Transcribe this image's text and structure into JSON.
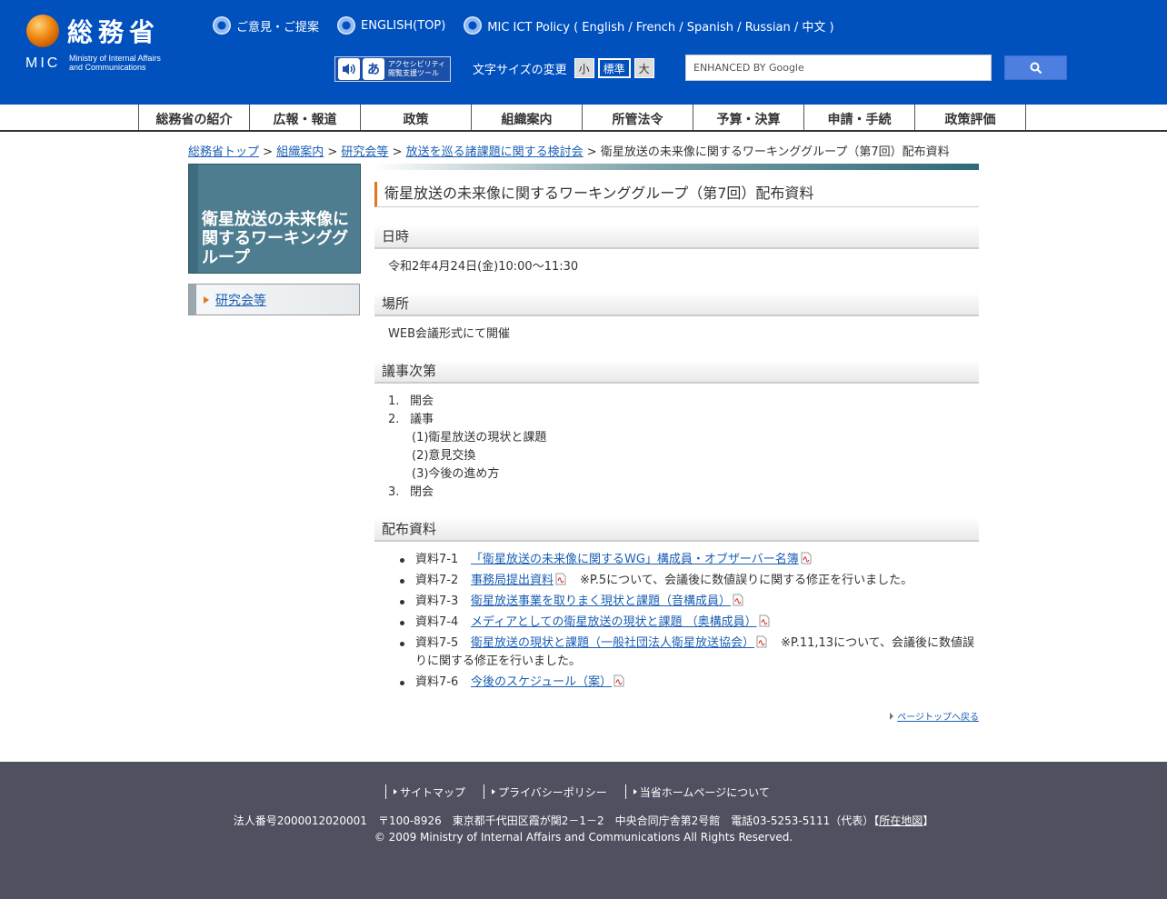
{
  "header": {
    "logo_jp": "総務省",
    "logo_mic": "MIC",
    "logo_en_line1": "Ministry of Internal Affairs",
    "logo_en_line2": "and Communications",
    "links": [
      {
        "label": "ご意見・ご提案"
      },
      {
        "label": "ENGLISH(TOP)"
      },
      {
        "label": "MIC ICT Policy ( English / French / Spanish / Russian / 中文 )"
      }
    ],
    "access_tool_line1": "アクセシビリティ",
    "access_tool_line2": "閲覧支援ツール",
    "fontsize_label": "文字サイズの変更",
    "fontsize_small": "小",
    "fontsize_standard": "標準",
    "fontsize_large": "大",
    "search_placeholder": "ENHANCED BY Google"
  },
  "gnav": [
    "総務省の紹介",
    "広報・報道",
    "政策",
    "組織案内",
    "所管法令",
    "予算・決算",
    "申請・手続",
    "政策評価"
  ],
  "breadcrumb": {
    "items": [
      "総務省トップ",
      "組織案内",
      "研究会等",
      "放送を巡る諸課題に関する検討会"
    ],
    "current": "衛星放送の未来像に関するワーキンググループ（第7回）配布資料",
    "separator": ">"
  },
  "sidebar": {
    "title": "衛星放送の未来像に関するワーキンググループ",
    "menu_item": "研究会等"
  },
  "main": {
    "title": "衛星放送の未来像に関するワーキンググループ（第7回）配布資料",
    "date_heading": "日時",
    "date_text": "令和2年4月24日(金)10:00～11:30",
    "place_heading": "場所",
    "place_text": "WEB会議形式にて開催",
    "agenda_heading": "議事次第",
    "agenda": [
      {
        "num": "1.",
        "label": "開会"
      },
      {
        "num": "2.",
        "label": "議事"
      },
      {
        "num": "3.",
        "label": "閉会"
      }
    ],
    "agenda_sub": [
      "(1)衛星放送の現状と課題",
      "(2)意見交換",
      "(3)今後の進め方"
    ],
    "materials_heading": "配布資料",
    "materials": [
      {
        "no": "資料7-1",
        "title": "「衛星放送の未来像に関するWG」構成員・オブザーバー名簿",
        "note": ""
      },
      {
        "no": "資料7-2",
        "title": "事務局提出資料",
        "note": "※P.5について、会議後に数値誤りに関する修正を行いました。"
      },
      {
        "no": "資料7-3",
        "title": "衛星放送事業を取りまく現状と課題（音構成員）",
        "note": ""
      },
      {
        "no": "資料7-4",
        "title": "メディアとしての衛星放送の現状と課題 （奥構成員）",
        "note": ""
      },
      {
        "no": "資料7-5",
        "title": "衛星放送の現状と課題（一般社団法人衛星放送協会）",
        "note": "※P.11,13について、会議後に数値誤りに関する修正を行いました。"
      },
      {
        "no": "資料7-6",
        "title": "今後のスケジュール（案）",
        "note": ""
      }
    ],
    "pagetop": "ページトップへ戻る"
  },
  "footer": {
    "links": [
      "サイトマップ",
      "プライバシーポリシー",
      "当省ホームページについて"
    ],
    "address_prefix": "法人番号2000012020001　〒100-8926　東京都千代田区霞が関2－1－2　中央合同庁舎第2号館　電話03-5253-5111（代表）【",
    "map_link": "所在地図",
    "address_suffix": "】",
    "copyright": "© 2009 Ministry of Internal Affairs and Communications All Rights Reserved."
  },
  "colors": {
    "header_bg": "#0050be",
    "footer_bg": "#4f5060",
    "accent_orange": "#e0781c",
    "link": "#1a5fb4"
  }
}
